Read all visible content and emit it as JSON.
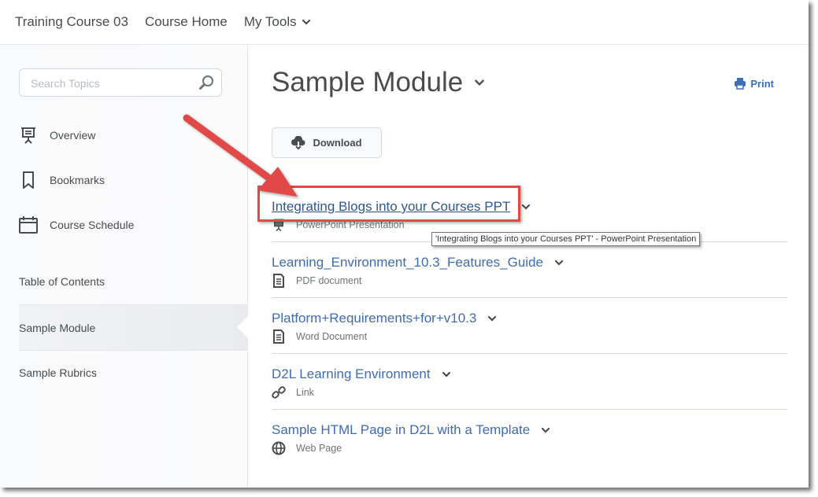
{
  "nav": {
    "course_name": "Training Course 03",
    "course_home": "Course Home",
    "my_tools": "My Tools"
  },
  "sidebar": {
    "search_placeholder": "Search Topics",
    "items": [
      {
        "label": "Overview",
        "icon": "presentation-icon"
      },
      {
        "label": "Bookmarks",
        "icon": "bookmark-icon"
      },
      {
        "label": "Course Schedule",
        "icon": "calendar-icon"
      }
    ],
    "toc": [
      {
        "label": "Table of Contents",
        "active": false
      },
      {
        "label": "Sample Module",
        "active": true
      },
      {
        "label": "Sample Rubrics",
        "active": false
      }
    ]
  },
  "main": {
    "title": "Sample Module",
    "print_label": "Print",
    "download_label": "Download",
    "topics": [
      {
        "title": "Integrating Blogs into your Courses PPT",
        "type": "PowerPoint Presentation",
        "icon": "presentation-icon"
      },
      {
        "title": "Learning_Environment_10.3_Features_Guide",
        "type": "PDF document",
        "icon": "document-icon"
      },
      {
        "title": "Platform+Requirements+for+v10.3",
        "type": "Word Document",
        "icon": "document-icon"
      },
      {
        "title": "D2L Learning Environment",
        "type": "Link",
        "icon": "link-icon"
      },
      {
        "title": "Sample HTML Page in D2L with a Template",
        "type": "Web Page",
        "icon": "globe-icon"
      }
    ],
    "tooltip": "'Integrating Blogs into your Courses PPT' - PowerPoint Presentation"
  },
  "colors": {
    "link": "#3f6bb5",
    "text": "#494c4e",
    "annotation": "#e04a46"
  }
}
